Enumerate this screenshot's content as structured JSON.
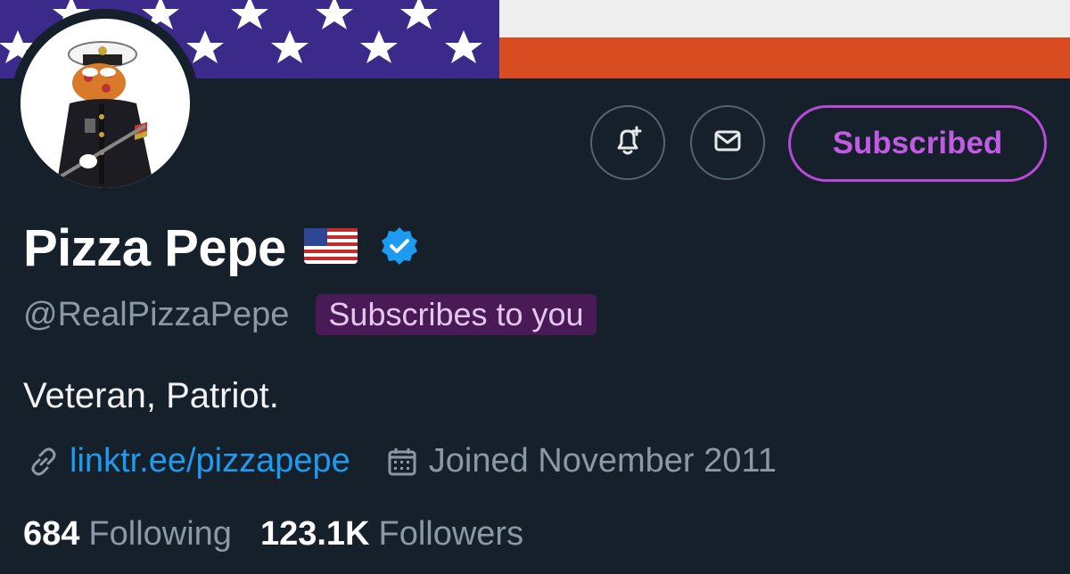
{
  "profile": {
    "display_name": "Pizza Pepe",
    "handle": "@RealPizzaPepe",
    "subscribes_badge": "Subscribes to you",
    "bio": "Veteran, Patriot.",
    "link": "linktr.ee/pizzapepe",
    "joined": "Joined November 2011",
    "following_count": "684",
    "following_label": "Following",
    "followers_count": "123.1K",
    "followers_label": "Followers"
  },
  "actions": {
    "subscribed_label": "Subscribed"
  },
  "colors": {
    "background": "#15202b",
    "accent_purple": "#c15be3",
    "link_blue": "#1d9bf0",
    "muted_gray": "#8b98a5",
    "verified_blue": "#1d9bf0",
    "banner_blue": "#3c2a8a",
    "banner_red": "#d74c20"
  },
  "icons": {
    "notify": "bell-plus-icon",
    "message": "envelope-icon",
    "verified": "verified-badge-icon",
    "flag": "us-flag-icon",
    "link": "link-icon",
    "calendar": "calendar-icon"
  }
}
